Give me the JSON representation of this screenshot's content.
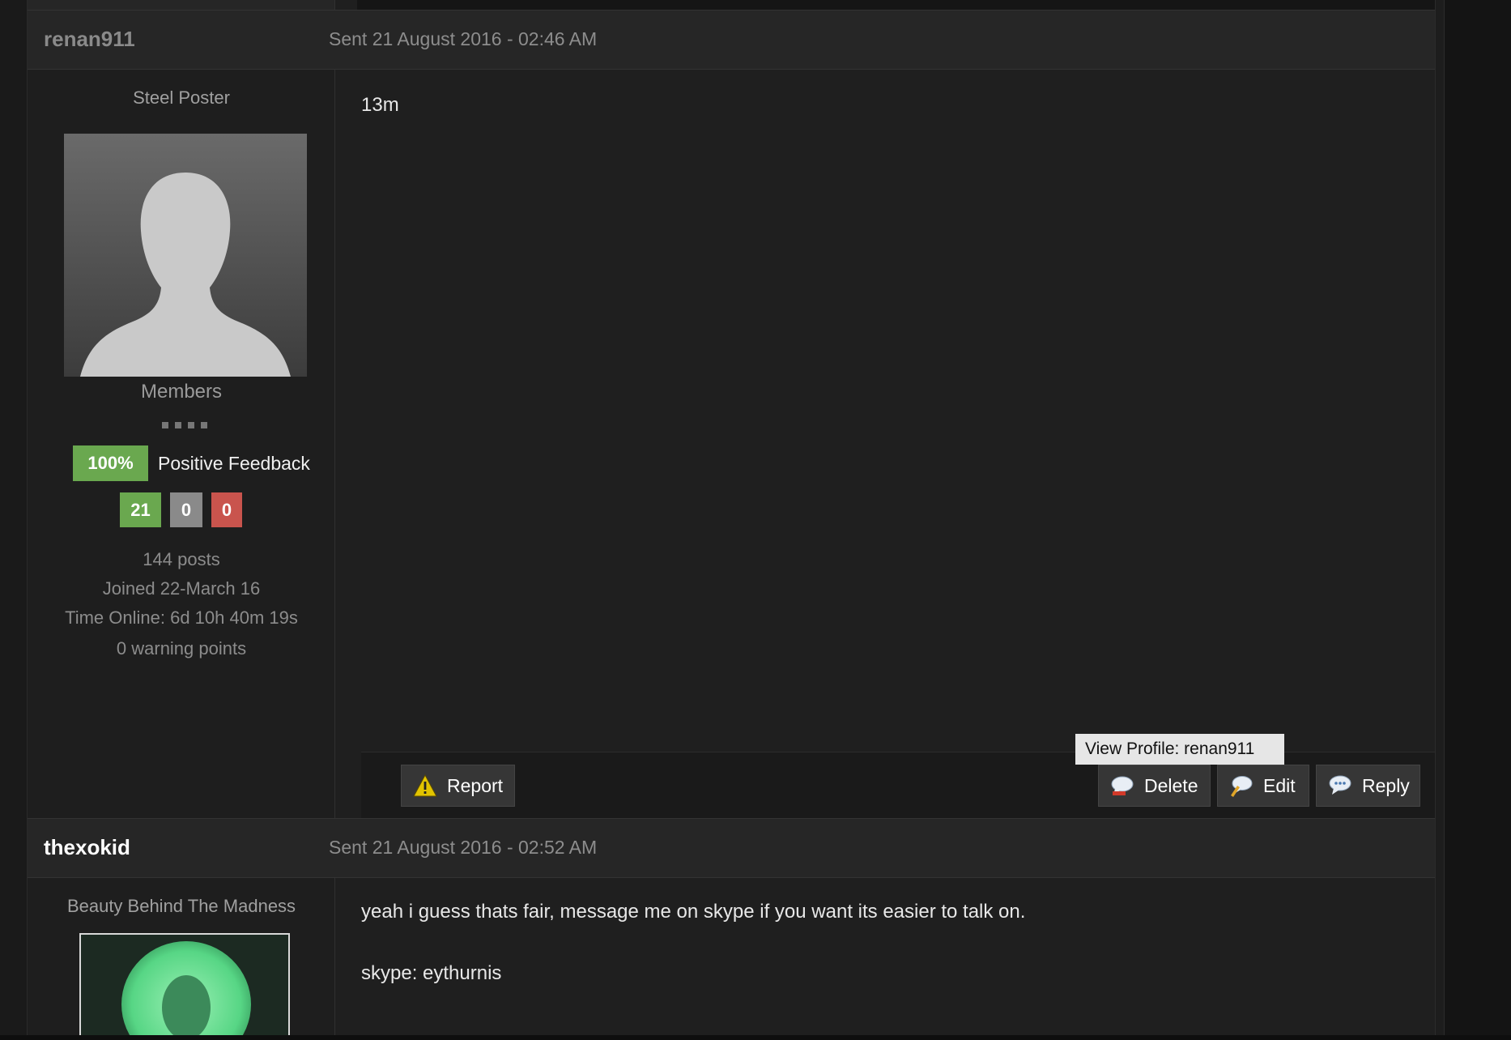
{
  "posts": [
    {
      "author": "renan911",
      "date": "Sent 21 August 2016 - 02:46 AM",
      "member_title": "Steel Poster",
      "group": "Members",
      "feedback_percent": "100%",
      "feedback_label": "Positive Feedback",
      "feedback_counts": {
        "positive": "21",
        "neutral": "0",
        "negative": "0"
      },
      "stats": {
        "posts": "144 posts",
        "joined": "Joined 22-March 16",
        "time_online": "Time Online: 6d 10h 40m 19s",
        "warning_points": "0 warning points"
      },
      "message": "13m",
      "actions": {
        "report": "Report",
        "delete": "Delete",
        "edit": "Edit",
        "reply": "Reply"
      },
      "tooltip": "View Profile: renan911"
    },
    {
      "author": "thexokid",
      "date": "Sent 21 August 2016 - 02:52 AM",
      "member_title": "Beauty Behind The Madness",
      "message_lines": [
        "yeah i guess thats fair, message me on skype if you want its easier to talk on.",
        "skype: eythurnis"
      ]
    }
  ],
  "colors": {
    "positive": "#6aa84f",
    "neutral": "#8a8a8a",
    "negative": "#c9544d",
    "background": "#222222"
  },
  "icons": {
    "report": "warning-triangle-icon",
    "delete": "speech-bubble-delete-icon",
    "edit": "speech-bubble-edit-icon",
    "reply": "speech-bubble-reply-icon"
  }
}
